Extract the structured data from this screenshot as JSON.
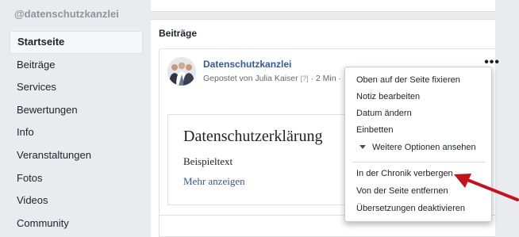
{
  "sidebar": {
    "handle": "@datenschutzkanzlei",
    "items": [
      {
        "label": "Startseite",
        "active": true
      },
      {
        "label": "Beiträge"
      },
      {
        "label": "Services"
      },
      {
        "label": "Bewertungen"
      },
      {
        "label": "Info"
      },
      {
        "label": "Veranstaltungen"
      },
      {
        "label": "Fotos"
      },
      {
        "label": "Videos"
      },
      {
        "label": "Community"
      }
    ]
  },
  "feed": {
    "title": "Beiträge",
    "post": {
      "author": "Datenschutzkanzlei",
      "byline": "Gepostet von Julia Kaiser",
      "help_marker": "[?]",
      "time": "· 2 Min ·",
      "more_icon": "more-dots-icon",
      "note": {
        "title": "Datenschutzerklärung",
        "body": "Beispieltext",
        "more_link": "Mehr anzeigen"
      }
    }
  },
  "menu": {
    "items": [
      {
        "label": "Oben auf der Seite fixieren"
      },
      {
        "label": "Notiz bearbeiten"
      },
      {
        "label": "Datum ändern"
      },
      {
        "label": "Einbetten"
      },
      {
        "label": "Weitere Optionen ansehen",
        "icon": "caret-down-icon"
      },
      {
        "label": "In der Chronik verbergen"
      },
      {
        "label": "Von der Seite entfernen"
      },
      {
        "label": "Übersetzungen deaktivieren"
      }
    ]
  },
  "colors": {
    "link": "#365899",
    "sidebar_bg": "#e9ebee",
    "arrow": "#c0131b"
  }
}
